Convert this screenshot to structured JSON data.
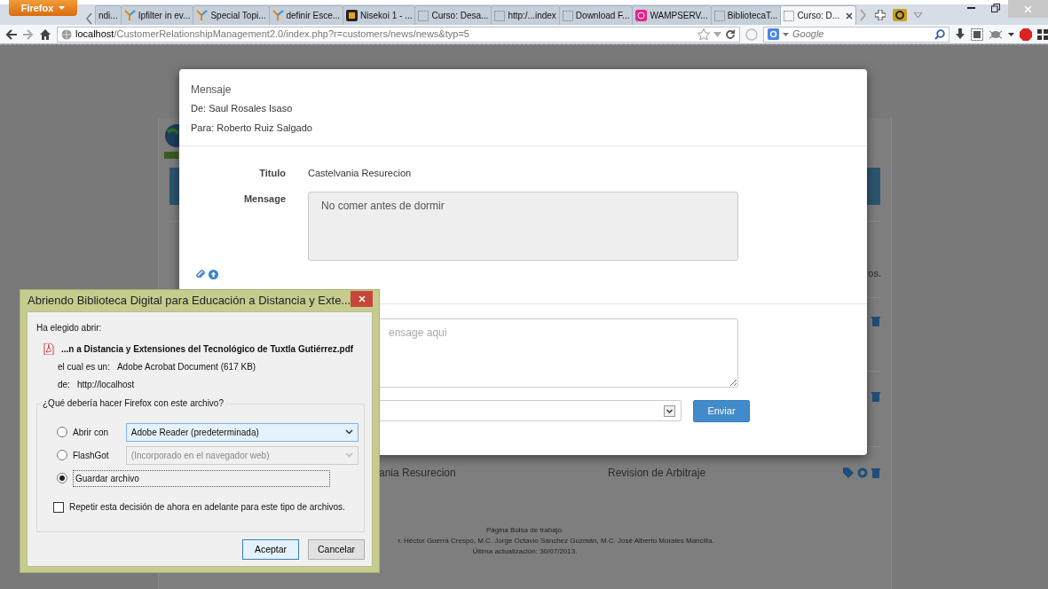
{
  "browser": {
    "menu_button": "Firefox",
    "tabs": [
      {
        "label": "ndi...",
        "kind": "plain",
        "selected": false
      },
      {
        "label": "Ipfilter in ev...",
        "kind": "leaf",
        "selected": false
      },
      {
        "label": "Special Topi...",
        "kind": "leaf",
        "selected": false
      },
      {
        "label": "definir Esce...",
        "kind": "leaf",
        "selected": false
      },
      {
        "label": "Nisekoi 1 - ...",
        "kind": "dark",
        "selected": false
      },
      {
        "label": "Curso: Desa...",
        "kind": "page",
        "selected": false
      },
      {
        "label": "http:/...index",
        "kind": "page",
        "selected": false
      },
      {
        "label": "Download F...",
        "kind": "page",
        "selected": false
      },
      {
        "label": "WAMPSERV...",
        "kind": "pink",
        "selected": false
      },
      {
        "label": "BibliotecaT...",
        "kind": "page",
        "selected": false
      },
      {
        "label": "Curso: D...",
        "kind": "page",
        "selected": true
      }
    ],
    "url": {
      "host": "localhost",
      "path": "/CustomerRelationshipManagement2.0/index.php?r=customers/news/news&typ=5"
    },
    "search": {
      "placeholder": "Google"
    }
  },
  "page": {
    "text_fragment": "os.",
    "row": {
      "title_fragment": "ania Resurecion",
      "subject": "Revision de Arbitraje"
    },
    "footer": [
      "Página Bolsa de trabajo.",
      "r. Héctor Guerra Crespo, M.C. Jorge Octavio Sánchez Guzmán, M.C. José Alberto Morales Mancilla.",
      "Última actualización: 30/07/2013."
    ]
  },
  "modal": {
    "title": "Mensaje",
    "from": "De: Saul Rosales Isaso",
    "to": "Para: Roberto Ruiz Salgado",
    "fields": [
      {
        "label": "Titulo",
        "value": "Castelvania Resurecion",
        "kind": "text"
      },
      {
        "label": "Mensage",
        "value": "No comer antes de dormir",
        "kind": "textarea"
      }
    ],
    "reply_placeholder": "ensage aqui",
    "send_button": "Enviar"
  },
  "dialog": {
    "title": "Abriendo Biblioteca Digital para Educación a Distancia y Exte...",
    "intro": "Ha elegido abrir:",
    "filename": "...n a Distancia y Extensiones del Tecnológico de Tuxtla Gutiérrez.pdf",
    "details": [
      {
        "label": "el cual es un:",
        "value": "Adobe Acrobat Document (617 KB)"
      },
      {
        "label": "de:",
        "value": "http://localhost"
      }
    ],
    "question": "¿Qué debería hacer Firefox con este archivo?",
    "options": [
      {
        "label": "Abrir con",
        "app": "Adobe Reader  (predeterminada)",
        "selected": false,
        "disabled": false
      },
      {
        "label": "FlashGot",
        "app": "(Incorporado en el navegador web)",
        "selected": false,
        "disabled": true
      },
      {
        "label": "Guardar archivo",
        "selected": true
      }
    ],
    "remember": {
      "label": "Repetir esta decisión de ahora en adelante para este tipo de archivos.",
      "checked": false
    },
    "buttons": [
      {
        "label": "Aceptar",
        "default": true
      },
      {
        "label": "Cancelar",
        "default": false
      }
    ]
  }
}
